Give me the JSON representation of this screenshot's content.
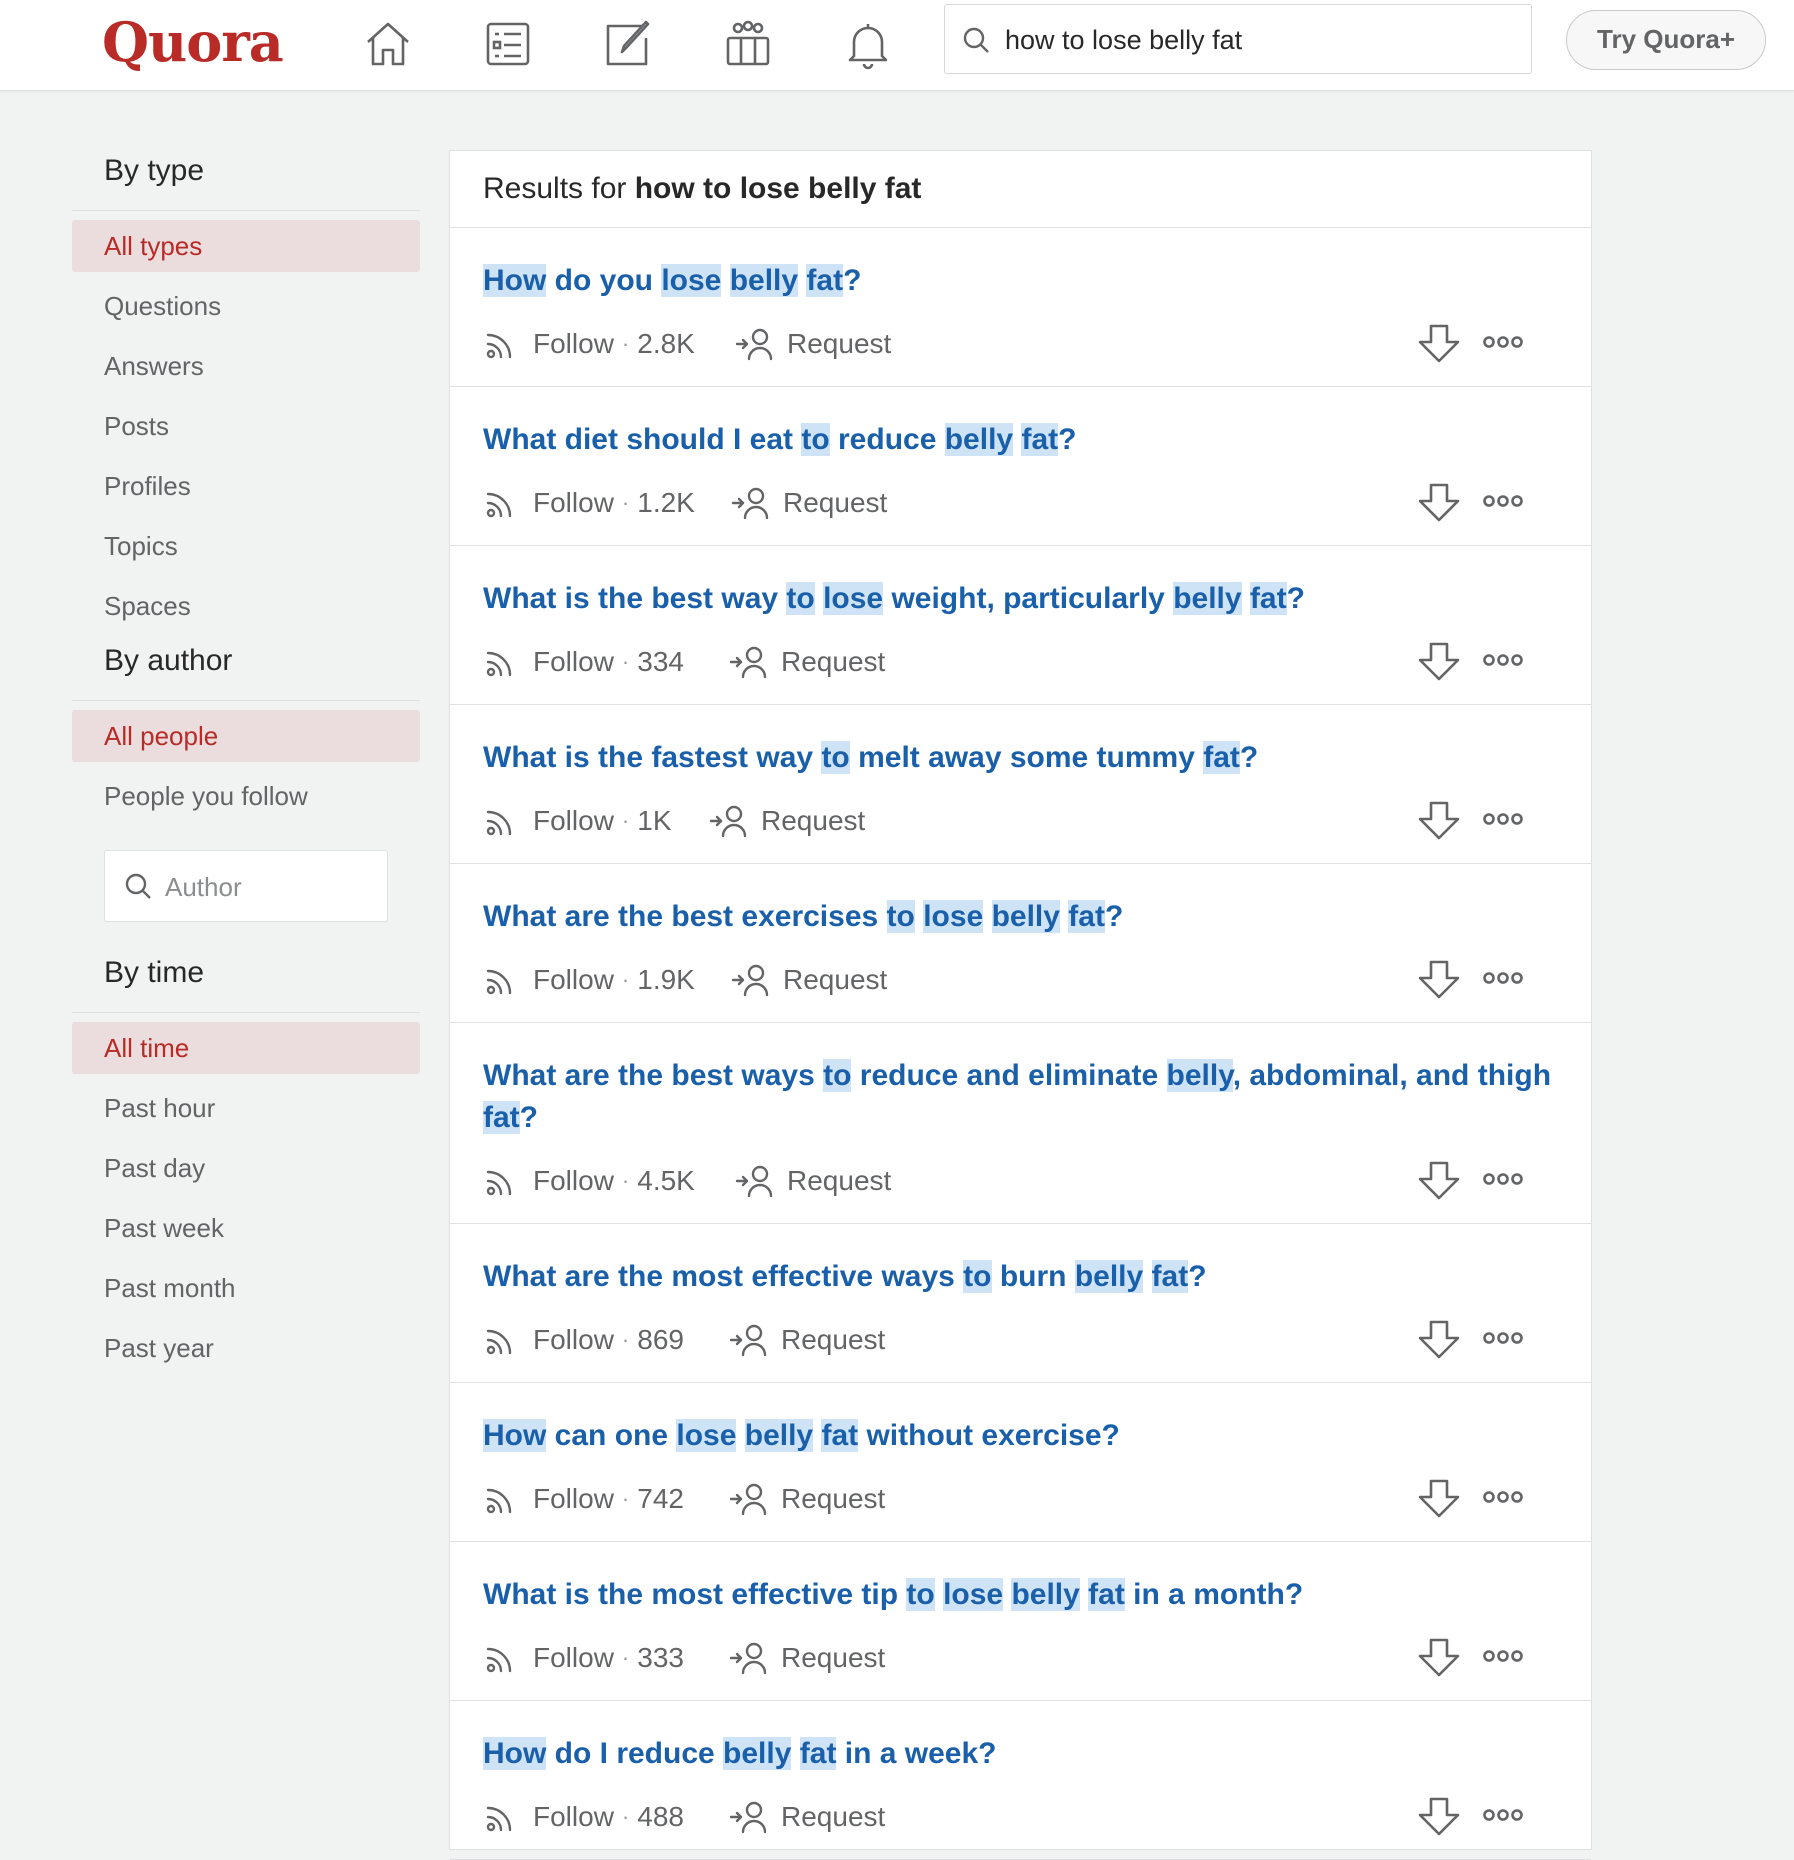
{
  "brand": {
    "logo": "Quora",
    "color": "#b92b27"
  },
  "nav": [
    {
      "name": "home-icon"
    },
    {
      "name": "answer-list-icon"
    },
    {
      "name": "write-icon"
    },
    {
      "name": "spaces-icon"
    },
    {
      "name": "notifications-icon"
    }
  ],
  "search": {
    "value": "how to lose belly fat"
  },
  "try_plus": "Try Quora+",
  "sidebar": {
    "by_type": {
      "heading": "By type",
      "items": [
        "All types",
        "Questions",
        "Answers",
        "Posts",
        "Profiles",
        "Topics",
        "Spaces"
      ],
      "active": "All types"
    },
    "by_author": {
      "heading": "By author",
      "items": [
        "All people",
        "People you follow"
      ],
      "active": "All people",
      "author_placeholder": "Author"
    },
    "by_time": {
      "heading": "By time",
      "items": [
        "All time",
        "Past hour",
        "Past day",
        "Past week",
        "Past month",
        "Past year"
      ],
      "active": "All time"
    }
  },
  "results_header": {
    "prefix": "Results for ",
    "query": "how to lose belly fat"
  },
  "results": [
    {
      "title": [
        [
          "How",
          true
        ],
        [
          " do you ",
          false
        ],
        [
          "lose",
          true
        ],
        [
          " ",
          false
        ],
        [
          "belly",
          true
        ],
        [
          " ",
          false
        ],
        [
          "fat",
          true
        ],
        [
          "?",
          false
        ]
      ],
      "follow": "Follow",
      "count": "2.8K",
      "request": "Request"
    },
    {
      "title": [
        [
          "What diet should I eat ",
          false
        ],
        [
          "to",
          true
        ],
        [
          " reduce ",
          false
        ],
        [
          "belly",
          true
        ],
        [
          " ",
          false
        ],
        [
          "fat",
          true
        ],
        [
          "?",
          false
        ]
      ],
      "follow": "Follow",
      "count": "1.2K",
      "request": "Request"
    },
    {
      "title": [
        [
          "What is the best way ",
          false
        ],
        [
          "to",
          true
        ],
        [
          " ",
          false
        ],
        [
          "lose",
          true
        ],
        [
          " weight, particularly ",
          false
        ],
        [
          "belly",
          true
        ],
        [
          " ",
          false
        ],
        [
          "fat",
          true
        ],
        [
          "?",
          false
        ]
      ],
      "follow": "Follow",
      "count": "334",
      "request": "Request"
    },
    {
      "title": [
        [
          "What is the fastest way ",
          false
        ],
        [
          "to",
          true
        ],
        [
          " melt away some tummy ",
          false
        ],
        [
          "fat",
          true
        ],
        [
          "?",
          false
        ]
      ],
      "follow": "Follow",
      "count": "1K",
      "request": "Request"
    },
    {
      "title": [
        [
          "What are the best exercises ",
          false
        ],
        [
          "to",
          true
        ],
        [
          " ",
          false
        ],
        [
          "lose",
          true
        ],
        [
          " ",
          false
        ],
        [
          "belly",
          true
        ],
        [
          " ",
          false
        ],
        [
          "fat",
          true
        ],
        [
          "?",
          false
        ]
      ],
      "follow": "Follow",
      "count": "1.9K",
      "request": "Request"
    },
    {
      "title": [
        [
          "What are the best ways ",
          false
        ],
        [
          "to",
          true
        ],
        [
          " reduce and eliminate ",
          false
        ],
        [
          "belly",
          true
        ],
        [
          ", abdominal, and thigh ",
          false
        ],
        [
          "fat",
          true
        ],
        [
          "?",
          false
        ]
      ],
      "follow": "Follow",
      "count": "4.5K",
      "request": "Request"
    },
    {
      "title": [
        [
          "What are the most effective ways ",
          false
        ],
        [
          "to",
          true
        ],
        [
          " burn ",
          false
        ],
        [
          "belly",
          true
        ],
        [
          " ",
          false
        ],
        [
          "fat",
          true
        ],
        [
          "?",
          false
        ]
      ],
      "follow": "Follow",
      "count": "869",
      "request": "Request"
    },
    {
      "title": [
        [
          "How",
          true
        ],
        [
          " can one ",
          false
        ],
        [
          "lose",
          true
        ],
        [
          " ",
          false
        ],
        [
          "belly",
          true
        ],
        [
          " ",
          false
        ],
        [
          "fat",
          true
        ],
        [
          " without exercise?",
          false
        ]
      ],
      "follow": "Follow",
      "count": "742",
      "request": "Request"
    },
    {
      "title": [
        [
          "What is the most effective tip ",
          false
        ],
        [
          "to",
          true
        ],
        [
          " ",
          false
        ],
        [
          "lose",
          true
        ],
        [
          " ",
          false
        ],
        [
          "belly",
          true
        ],
        [
          " ",
          false
        ],
        [
          "fat",
          true
        ],
        [
          " in a month?",
          false
        ]
      ],
      "follow": "Follow",
      "count": "333",
      "request": "Request"
    },
    {
      "title": [
        [
          "How",
          true
        ],
        [
          " do I reduce ",
          false
        ],
        [
          "belly",
          true
        ],
        [
          " ",
          false
        ],
        [
          "fat",
          true
        ],
        [
          " in a week?",
          false
        ]
      ],
      "follow": "Follow",
      "count": "488",
      "request": "Request"
    }
  ],
  "colors": {
    "link": "#195faa",
    "highlight": "#cfe3f6",
    "active_bg": "#ebdcdd",
    "active_text": "#b92b27"
  }
}
